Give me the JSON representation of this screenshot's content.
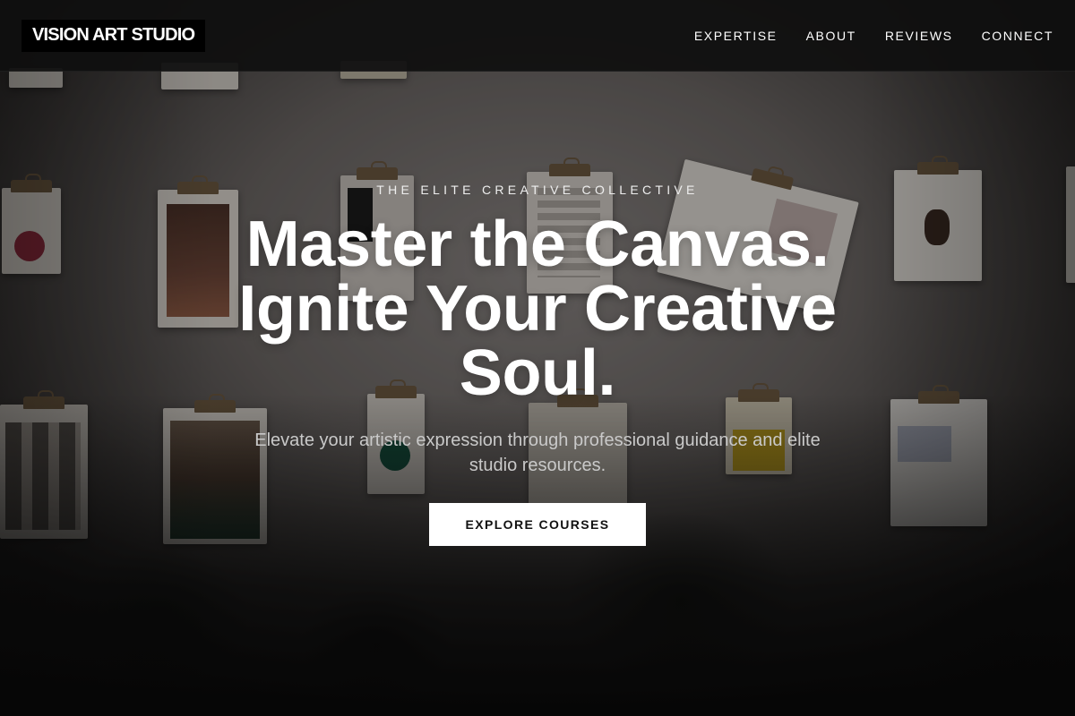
{
  "brand": {
    "logo_text": "VISION ART STUDIO"
  },
  "nav": {
    "items": [
      {
        "label": "EXPERTISE"
      },
      {
        "label": "ABOUT"
      },
      {
        "label": "REVIEWS"
      },
      {
        "label": "CONNECT"
      }
    ]
  },
  "hero": {
    "eyebrow": "THE ELITE CREATIVE COLLECTIVE",
    "headline_lines": [
      "Master the Canvas.",
      "Ignite Your Creative",
      "Soul."
    ],
    "subtext": "Elevate your artistic expression through professional guidance and elite studio resources.",
    "cta_label": "EXPLORE COURSES"
  },
  "colors": {
    "navbar_bg": "#0f0f0f",
    "logo_bg": "#000000",
    "text_primary": "#ffffff",
    "text_muted": "#c9c9c9",
    "cta_bg": "#ffffff",
    "cta_text": "#111111"
  },
  "background_image": {
    "subject": "wall of clipboards holding prints and magazine pages with plants in foreground"
  }
}
